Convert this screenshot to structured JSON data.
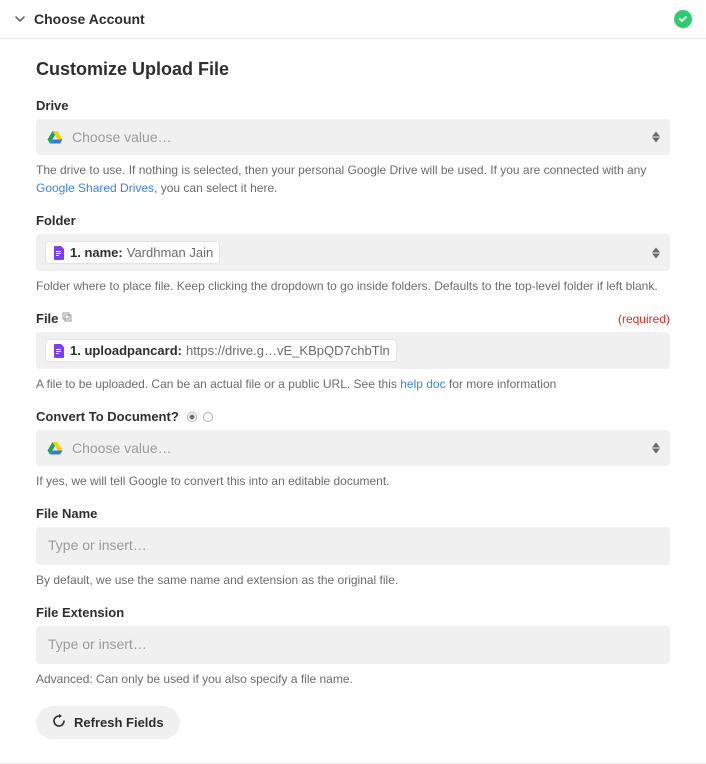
{
  "header": {
    "title": "Choose Account"
  },
  "page": {
    "title": "Customize Upload File"
  },
  "fields": {
    "drive": {
      "label": "Drive",
      "placeholder": "Choose value…",
      "help_pre": "The drive to use. If nothing is selected, then your personal Google Drive will be used. If you are connected with any ",
      "help_link": "Google Shared Drives",
      "help_post": ", you can select it here."
    },
    "folder": {
      "label": "Folder",
      "pill_key": "1. name:",
      "pill_val": "Vardhman Jain",
      "help": "Folder where to place file. Keep clicking the dropdown to go inside folders. Defaults to the top-level folder if left blank."
    },
    "file": {
      "label": "File",
      "required": "(required)",
      "pill_key": "1. uploadpancard:",
      "pill_val": "https://drive.g…vE_KBpQD7chbTln",
      "help_pre": "A file to be uploaded. Can be an actual file or a public URL. See this ",
      "help_link": "help doc",
      "help_post": " for more information"
    },
    "convert": {
      "label": "Convert To Document?",
      "placeholder": "Choose value…",
      "help": "If yes, we will tell Google to convert this into an editable document."
    },
    "filename": {
      "label": "File Name",
      "placeholder": "Type or insert…",
      "help": "By default, we use the same name and extension as the original file."
    },
    "fileext": {
      "label": "File Extension",
      "placeholder": "Type or insert…",
      "help": "Advanced: Can only be used if you also specify a file name."
    }
  },
  "actions": {
    "refresh": "Refresh Fields"
  }
}
